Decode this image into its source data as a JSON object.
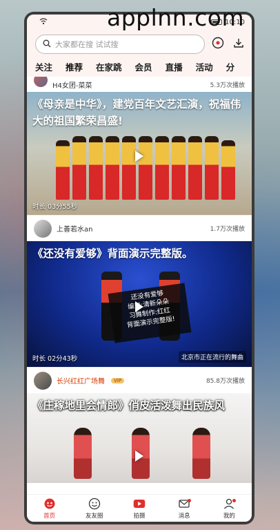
{
  "watermark": "applnn.com",
  "status_bar": {
    "time": "10:10"
  },
  "search": {
    "placeholder": "大家都在搜 试试搜"
  },
  "tabs": [
    "关注",
    "推荐",
    "在家跳",
    "会员",
    "直播",
    "活动",
    "分"
  ],
  "feed": [
    {
      "author": "H4女团-菜菜",
      "plays": "5.3万次播放",
      "title": "《母亲是中华》，建党百年文艺汇演，祝福伟大的祖国繁荣昌盛!",
      "duration_label": "时长",
      "duration": "03分55秒"
    },
    {
      "author": "上善若水an",
      "plays": "1.7万次播放",
      "title": "《还没有爱够》背面演示完整版。",
      "duration_label": "时长",
      "duration": "02分43秒",
      "caption_lines": [
        "还没有爱够",
        "编舞:清新朵朵",
        "习舞制作:红红",
        "背面演示完整版!"
      ],
      "location": "北京市正在流行的舞曲"
    },
    {
      "author": "长兴红红广场舞",
      "badge": "VIP",
      "plays": "85.8万次播放",
      "title": "《庄稼地里会情郎》俏皮活泼舞出民族风"
    }
  ],
  "bottom_nav": [
    {
      "label": "首页",
      "icon": "home-icon"
    },
    {
      "label": "友友圈",
      "icon": "smile-icon"
    },
    {
      "label": "拍摄",
      "icon": "record-icon"
    },
    {
      "label": "消息",
      "icon": "mail-icon"
    },
    {
      "label": "我的",
      "icon": "profile-icon"
    }
  ],
  "colors": {
    "accent": "#e12e2e",
    "tab_bg": "#fdf4f2"
  }
}
